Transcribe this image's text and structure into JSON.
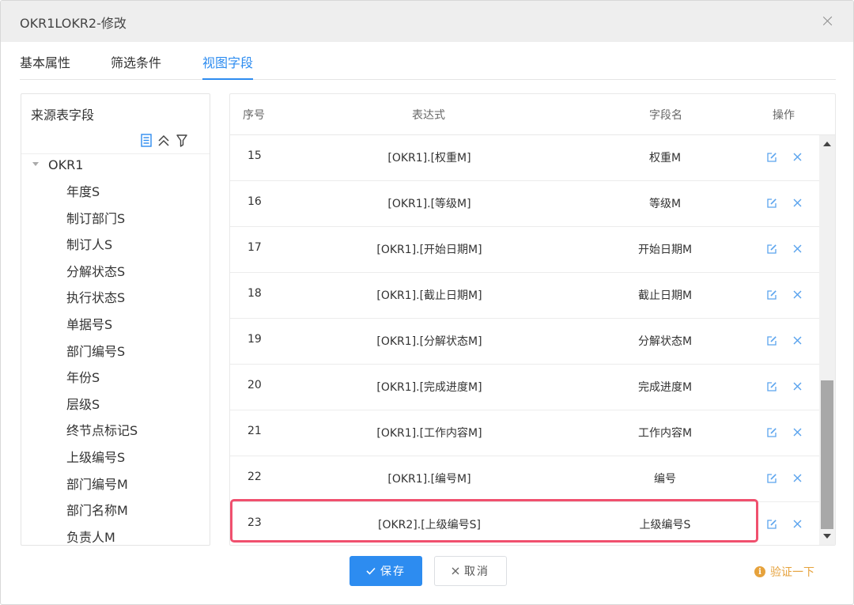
{
  "dialog": {
    "title": "OKR1LOKR2-修改"
  },
  "tabs": [
    {
      "label": "基本属性"
    },
    {
      "label": "筛选条件"
    },
    {
      "label": "视图字段",
      "active": true
    }
  ],
  "source_panel": {
    "title": "来源表字段",
    "root": "OKR1",
    "fields": [
      "年度S",
      "制订部门S",
      "制订人S",
      "分解状态S",
      "执行状态S",
      "单据号S",
      "部门编号S",
      "年份S",
      "层级S",
      "终节点标记S",
      "上级编号S",
      "部门编号M",
      "部门名称M",
      "负责人M"
    ]
  },
  "grid": {
    "headers": {
      "no": "序号",
      "expr": "表达式",
      "name": "字段名",
      "ops": "操作"
    },
    "rows": [
      {
        "no": "15",
        "expr": "[OKR1].[权重M]",
        "name": "权重M"
      },
      {
        "no": "16",
        "expr": "[OKR1].[等级M]",
        "name": "等级M"
      },
      {
        "no": "17",
        "expr": "[OKR1].[开始日期M]",
        "name": "开始日期M"
      },
      {
        "no": "18",
        "expr": "[OKR1].[截止日期M]",
        "name": "截止日期M"
      },
      {
        "no": "19",
        "expr": "[OKR1].[分解状态M]",
        "name": "分解状态M"
      },
      {
        "no": "20",
        "expr": "[OKR1].[完成进度M]",
        "name": "完成进度M"
      },
      {
        "no": "21",
        "expr": "[OKR1].[工作内容M]",
        "name": "工作内容M"
      },
      {
        "no": "22",
        "expr": "[OKR1].[编号M]",
        "name": "编号"
      },
      {
        "no": "23",
        "expr": "[OKR2].[上级编号S]",
        "name": "上级编号S"
      }
    ]
  },
  "footer": {
    "save": "保存",
    "cancel": "取消",
    "verify": "验证一下"
  },
  "colors": {
    "primary": "#2d8cf0",
    "highlight": "#f0506e",
    "warning": "#e6a23c"
  }
}
